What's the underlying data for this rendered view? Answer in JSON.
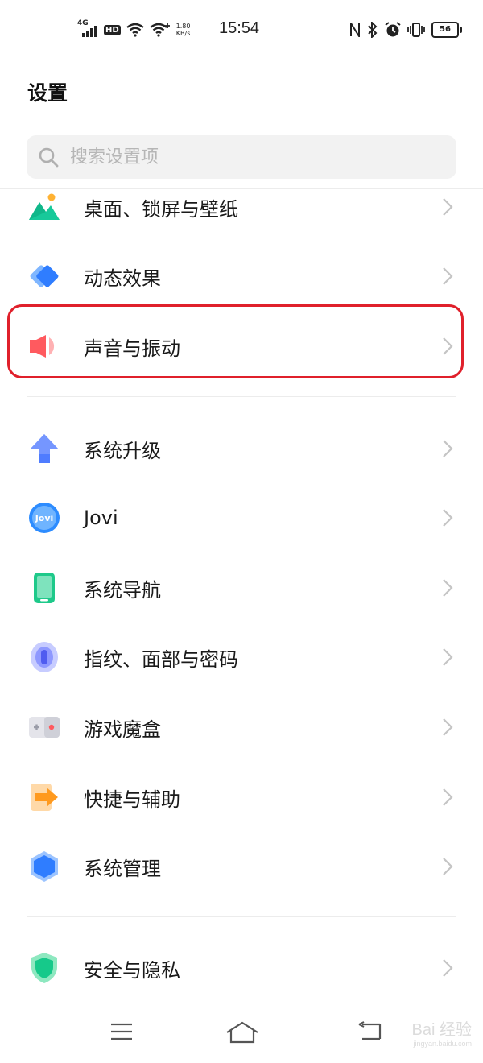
{
  "status_bar": {
    "network": "4G",
    "hd": "HD",
    "speed_value": "1.80",
    "speed_unit": "KB/s",
    "time": "15:54",
    "battery": "56"
  },
  "header": {
    "title": "设置"
  },
  "search": {
    "placeholder": "搜索设置项"
  },
  "settings": [
    {
      "label": "桌面、锁屏与壁纸",
      "icon": "wallpaper-icon"
    },
    {
      "label": "动态效果",
      "icon": "dynamic-effects-icon"
    },
    {
      "label": "声音与振动",
      "icon": "sound-vibration-icon",
      "highlighted": true
    },
    {
      "label": "系统升级",
      "icon": "system-upgrade-icon"
    },
    {
      "label": "Jovi",
      "icon": "jovi-icon"
    },
    {
      "label": "系统导航",
      "icon": "system-navigation-icon"
    },
    {
      "label": "指纹、面部与密码",
      "icon": "fingerprint-icon"
    },
    {
      "label": "游戏魔盒",
      "icon": "game-box-icon"
    },
    {
      "label": "快捷与辅助",
      "icon": "shortcuts-icon"
    },
    {
      "label": "系统管理",
      "icon": "system-management-icon"
    },
    {
      "label": "安全与隐私",
      "icon": "security-privacy-icon"
    }
  ],
  "icon_text": {
    "jovi": "Jovi"
  },
  "watermark": {
    "brand": "Bai 经验",
    "url": "jingyan.baidu.com"
  },
  "colors": {
    "highlight": "#e0202b",
    "search_bg": "#f2f2f2"
  }
}
